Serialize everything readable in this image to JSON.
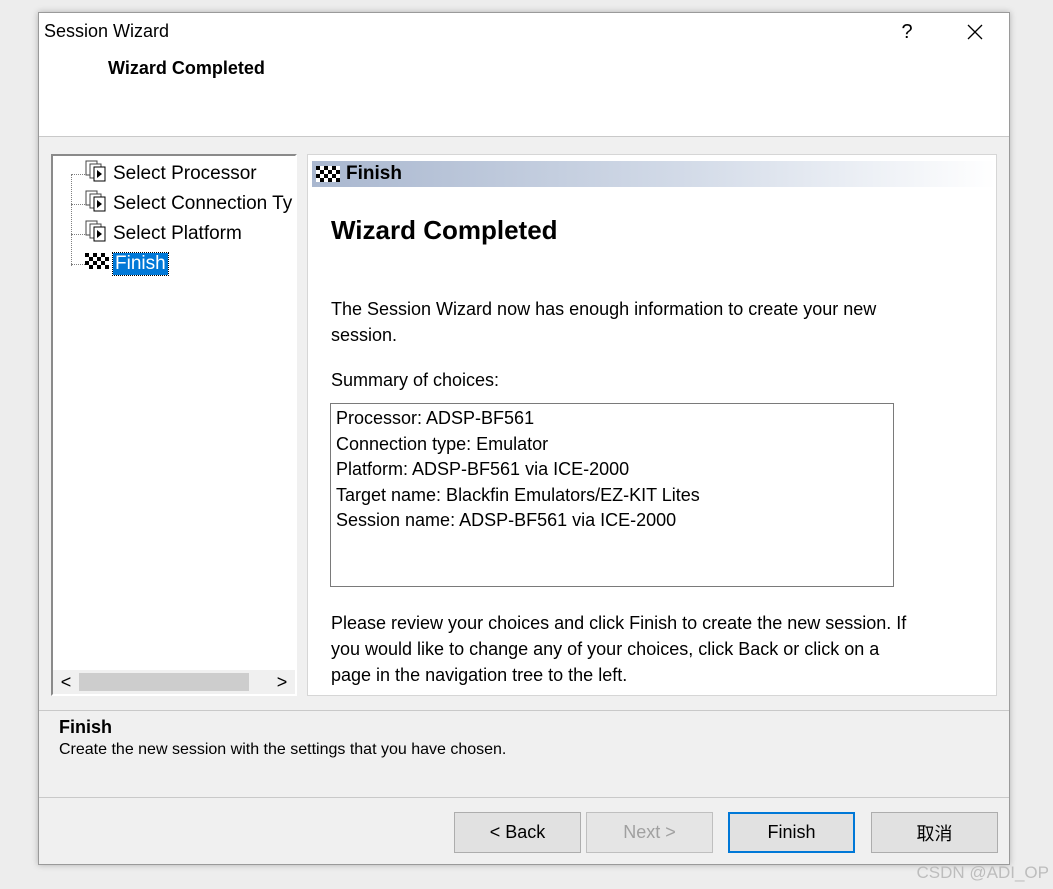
{
  "window": {
    "title": "Session Wizard",
    "help_label": "?"
  },
  "header": {
    "subtitle": "Wizard Completed"
  },
  "tree": {
    "items": [
      {
        "label": "Select Processor"
      },
      {
        "label": "Select Connection Ty"
      },
      {
        "label": "Select Platform"
      },
      {
        "label": "Finish",
        "selected": true
      }
    ],
    "scroll_left": "<",
    "scroll_right": ">"
  },
  "page": {
    "banner_title": "Finish",
    "heading": "Wizard Completed",
    "intro": "The Session Wizard now has enough information to create your new session.",
    "summary_label": "Summary of choices:",
    "summary_lines": [
      "Processor: ADSP-BF561",
      "Connection type: Emulator",
      "Platform: ADSP-BF561 via ICE-2000",
      "Target name: Blackfin Emulators/EZ-KIT Lites",
      "Session name: ADSP-BF561 via ICE-2000"
    ],
    "outro": "Please review your choices and click Finish to create the new session.  If you would like to change any of your choices, click Back or click on a page in the navigation tree to the left."
  },
  "hint": {
    "title": "Finish",
    "text": "Create the new session with the settings that you have chosen."
  },
  "buttons": {
    "back": "< Back",
    "next": "Next >",
    "finish": "Finish",
    "cancel": "取消"
  },
  "watermark": "CSDN @ADI_OP",
  "colors": {
    "selection": "#0078d7",
    "banner_start": "#a9b7cf"
  }
}
